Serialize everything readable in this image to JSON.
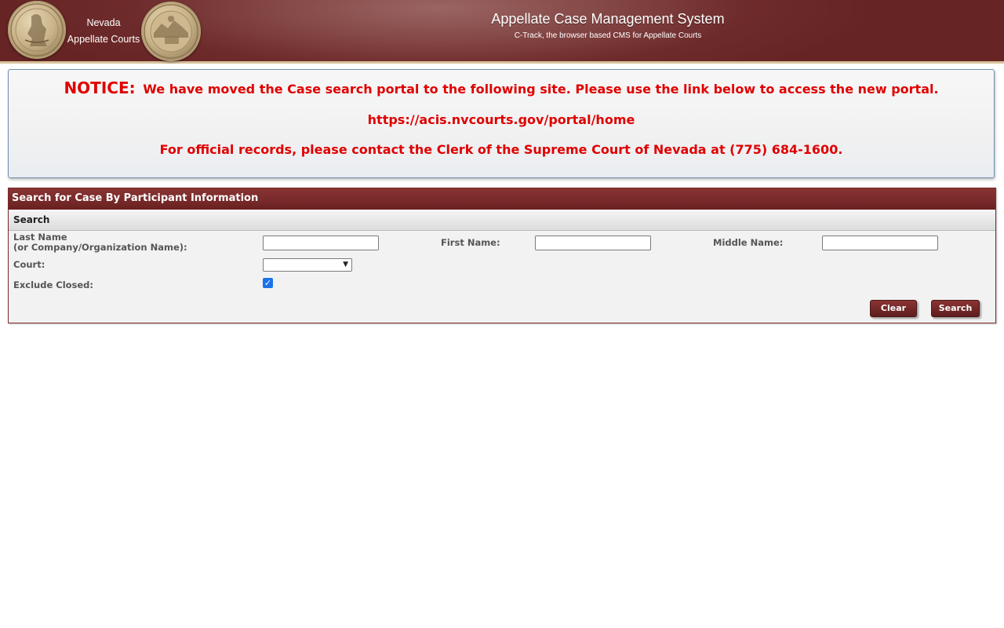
{
  "header": {
    "brand_line1": "Nevada",
    "brand_line2": "Appellate Courts",
    "title": "Appellate Case Management System",
    "subtitle": "C-Track, the browser based CMS for Appellate Courts",
    "left_seal_icon": "nevada-state-seal-icon",
    "right_seal_icon": "nevada-court-seal-icon"
  },
  "notice": {
    "label": "NOTICE:",
    "message": "We have moved the Case search portal to the following site. Please use the link below to access the new portal.",
    "link": "https://acis.nvcourts.gov/portal/home",
    "contact": "For official records, please contact the Clerk of the Supreme Court of Nevada at (775) 684-1600."
  },
  "search_panel": {
    "title": "Search for Case By Participant Information",
    "section": "Search",
    "last_name_label_1": "Last Name",
    "last_name_label_2": "(or Company/Organization Name):",
    "last_name_value": "",
    "first_name_label": "First Name:",
    "first_name_value": "",
    "middle_name_label": "Middle Name:",
    "middle_name_value": "",
    "court_label": "Court:",
    "court_value": "",
    "exclude_closed_label": "Exclude Closed:",
    "exclude_closed_checked": true,
    "clear_label": "Clear",
    "search_label": "Search"
  },
  "colors": {
    "header": "#6e2b2b",
    "panel_header": "#7a2a2a",
    "notice_text": "#e00000",
    "checkbox": "#1a73e8"
  }
}
